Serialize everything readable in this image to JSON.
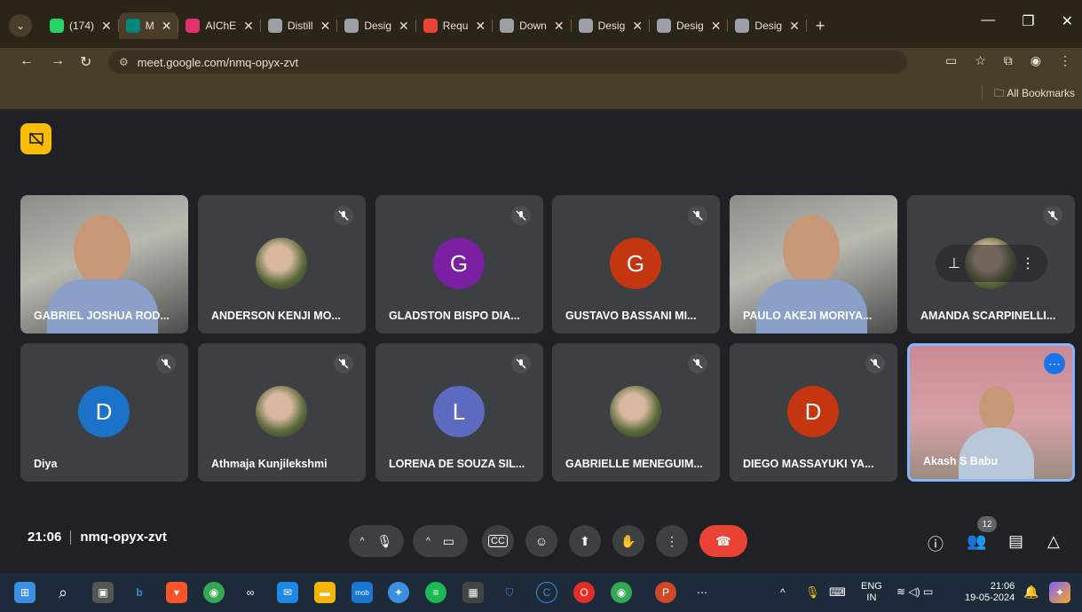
{
  "browser": {
    "tabs": [
      {
        "label": "(174)",
        "color": "#25d366"
      },
      {
        "label": "M",
        "color": "#00897b",
        "active": true
      },
      {
        "label": "AIChE",
        "color": "#e1306c"
      },
      {
        "label": "Distill",
        "color": "#9aa0a6"
      },
      {
        "label": "Desig",
        "color": "#9aa0a6"
      },
      {
        "label": "Requ",
        "color": "#ea4335"
      },
      {
        "label": "Down",
        "color": "#9aa0a6"
      },
      {
        "label": "Desig",
        "color": "#9aa0a6"
      },
      {
        "label": "Desig",
        "color": "#9aa0a6"
      },
      {
        "label": "Desig",
        "color": "#9aa0a6"
      }
    ],
    "url": "meet.google.com/nmq-opyx-zvt",
    "bookmarks_label": "All Bookmarks"
  },
  "participants": [
    {
      "name": "GABRIEL JOSHUA ROD...",
      "type": "video"
    },
    {
      "name": "ANDERSON KENJI MO...",
      "type": "photo",
      "muted": true
    },
    {
      "name": "GLADSTON BISPO DIA...",
      "type": "letter",
      "letter": "G",
      "color": "#7b1fa2",
      "muted": true
    },
    {
      "name": "GUSTAVO BASSANI MI...",
      "type": "letter",
      "letter": "G",
      "color": "#c4360f",
      "muted": true
    },
    {
      "name": "PAULO AKEJI MORIYA...",
      "type": "video"
    },
    {
      "name": "AMANDA SCARPINELLI...",
      "type": "photo",
      "muted": true,
      "pinned": true
    },
    {
      "name": "Diya",
      "type": "letter",
      "letter": "D",
      "color": "#1a73c8",
      "muted": true
    },
    {
      "name": "Athmaja Kunjilekshmi",
      "type": "photo",
      "muted": true
    },
    {
      "name": "LORENA DE SOUZA SIL...",
      "type": "letter",
      "letter": "L",
      "color": "#5c6bc0",
      "muted": true
    },
    {
      "name": "GABRIELLE MENEGUIM...",
      "type": "photo",
      "muted": true
    },
    {
      "name": "DIEGO MASSAYUKI YA...",
      "type": "letter",
      "letter": "D",
      "color": "#c4360f",
      "muted": true
    },
    {
      "name": "Akash S Babu",
      "type": "video",
      "selected": true
    }
  ],
  "meeting": {
    "time": "21:06",
    "code": "nmq-opyx-zvt",
    "participant_count": "12"
  },
  "taskbar": {
    "lang": "ENG",
    "region": "IN",
    "time": "21:06",
    "date": "19-05-2024"
  }
}
